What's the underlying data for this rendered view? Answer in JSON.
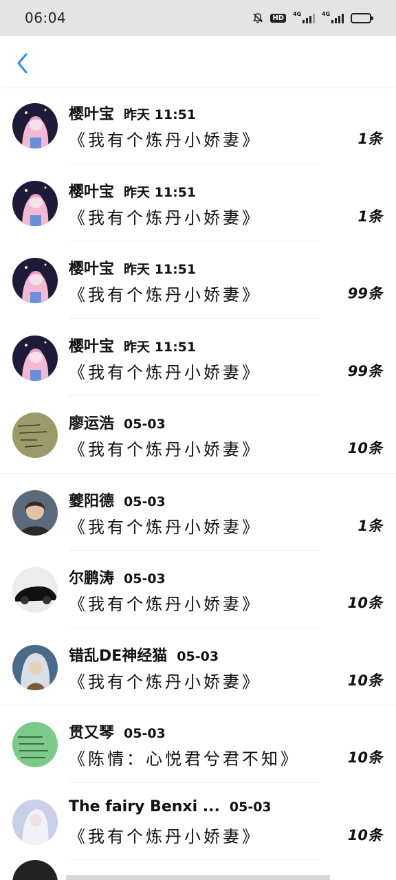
{
  "status_bar": {
    "time": "06:04",
    "hd_label": "HD",
    "signal1_label": "4G",
    "signal2_label": "4G"
  },
  "header": {
    "back_icon": "chevron-left-icon",
    "accent_color": "#2a8fe0"
  },
  "messages": [
    {
      "name": "樱叶宝",
      "time": "昨天 11:51",
      "text": "《我有个炼丹小娇妻》",
      "count": "1条",
      "avatar": "anime-girl-pink"
    },
    {
      "name": "樱叶宝",
      "time": "昨天 11:51",
      "text": "《我有个炼丹小娇妻》",
      "count": "1条",
      "avatar": "anime-girl-pink"
    },
    {
      "name": "樱叶宝",
      "time": "昨天 11:51",
      "text": "《我有个炼丹小娇妻》",
      "count": "99条",
      "avatar": "anime-girl-pink"
    },
    {
      "name": "樱叶宝",
      "time": "昨天 11:51",
      "text": "《我有个炼丹小娇妻》",
      "count": "99条",
      "avatar": "anime-girl-pink"
    },
    {
      "name": "廖运浩",
      "time": "05-03",
      "text": "《我有个炼丹小娇妻》",
      "count": "10条",
      "avatar": "handwriting-olive"
    },
    {
      "name": "夔阳德",
      "time": "05-03",
      "text": "《我有个炼丹小娇妻》",
      "count": "1条",
      "avatar": "person-dark-hair"
    },
    {
      "name": "尔鹏涛",
      "time": "05-03",
      "text": "《我有个炼丹小娇妻》",
      "count": "10条",
      "avatar": "black-car"
    },
    {
      "name": "错乱DE神经猫",
      "time": "05-03",
      "text": "《我有个炼丹小娇妻》",
      "count": "10条",
      "avatar": "silver-hair-character"
    },
    {
      "name": "贯又琴",
      "time": "05-03",
      "text": "《陈情：心悦君兮君不知》",
      "count": "10条",
      "avatar": "green-note"
    },
    {
      "name": "The fairy Benxi ...",
      "time": "05-03",
      "text": "《我有个炼丹小娇妻》",
      "count": "10条",
      "avatar": "fairy-white"
    }
  ]
}
